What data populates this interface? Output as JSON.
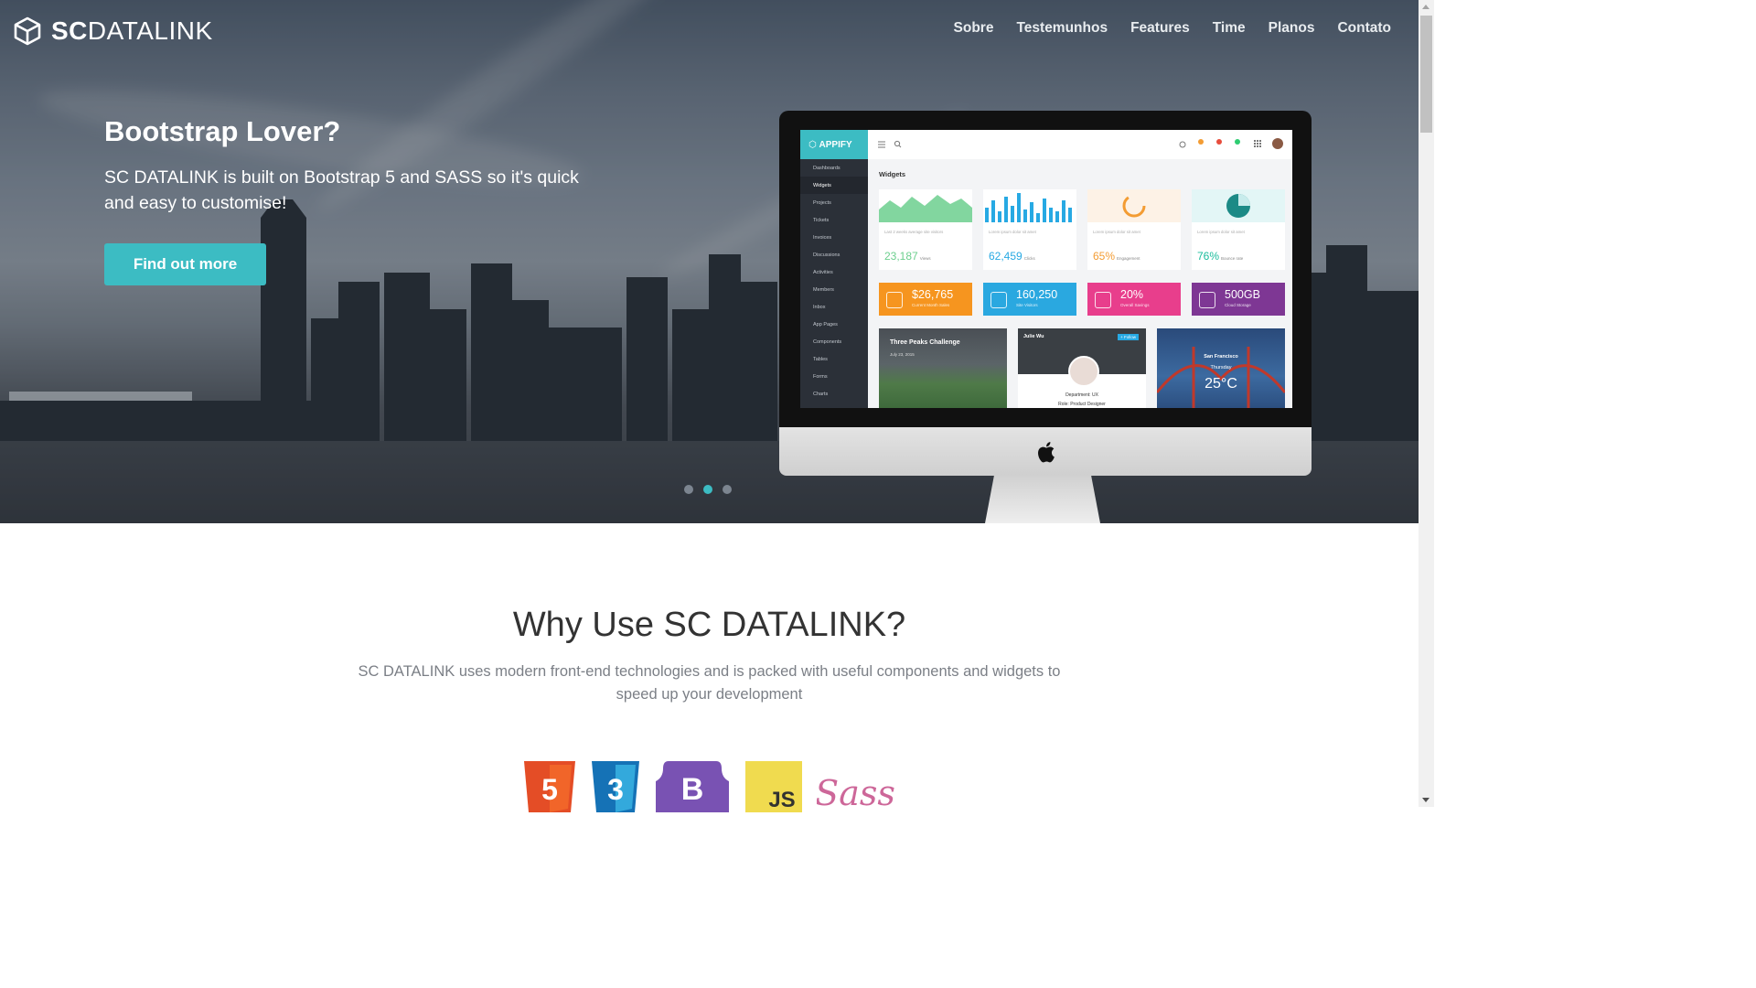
{
  "brand": {
    "bold": "SC",
    "rest": "DATALINK",
    "icon": "cube-icon"
  },
  "nav": [
    "Sobre",
    "Testemunhos",
    "Features",
    "Time",
    "Planos",
    "Contato"
  ],
  "hero": {
    "title": "Bootstrap Lover?",
    "subtitle": "SC DATALINK is built on Bootstrap 5 and SASS so it's quick and easy to customise!",
    "cta": "Find out more",
    "active_slide": 2,
    "slide_count": 3
  },
  "mockup": {
    "app_name": "APPIFY",
    "page_title": "Widgets",
    "menu": [
      "Dashboards",
      "Widgets",
      "Projects",
      "Tickets",
      "Invoices",
      "Discussions",
      "Activities",
      "Members",
      "Inbox",
      "App Pages",
      "Components",
      "Tables",
      "Forms",
      "Charts"
    ],
    "widgets": [
      {
        "value": "23,187",
        "caption": "Views",
        "desc": "Last 2 weeks average site visitors",
        "color": "#6ccf8e"
      },
      {
        "value": "62,459",
        "caption": "Clicks",
        "desc": "Lorem ipsum dolor sit amet",
        "color": "#27a9e3"
      },
      {
        "value": "65%",
        "caption": "Engagement",
        "desc": "Lorem ipsum dolor sit amet",
        "color": "#f39c33"
      },
      {
        "value": "76%",
        "caption": "Bounce rate",
        "desc": "Lorem ipsum dolor sit amet",
        "color": "#1abc9c"
      }
    ],
    "stats": [
      {
        "value": "$26,765",
        "label": "Current Month Sales",
        "color": "#f6951f"
      },
      {
        "value": "160,250",
        "label": "Site Visitors",
        "color": "#2aa8e0"
      },
      {
        "value": "20%",
        "label": "Overall Savings",
        "color": "#e83e8c"
      },
      {
        "value": "500GB",
        "label": "Cloud Storage",
        "color": "#7e3794"
      }
    ],
    "cards": {
      "peaks_title": "Three Peaks Challenge",
      "peaks_date": "July 23, 2015",
      "profile_name": "Julie Wu",
      "profile_follow": "+ Follow",
      "profile_dept": "Department: UX",
      "profile_role": "Role: Product Designer",
      "weather_city": "San Francisco",
      "weather_day": "Thursday",
      "weather_temp": "25°C"
    }
  },
  "why": {
    "title": "Why Use SC DATALINK?",
    "subtitle": "SC DATALINK uses modern front-end technologies and is packed with useful components and widgets to speed up your development"
  },
  "tech_logos": [
    "html5-logo",
    "css3-logo",
    "bootstrap-logo",
    "javascript-logo",
    "sass-logo"
  ],
  "tech_text": {
    "html": "5",
    "css": "3",
    "bootstrap": "B",
    "js": "JS",
    "sass": "Sass"
  }
}
